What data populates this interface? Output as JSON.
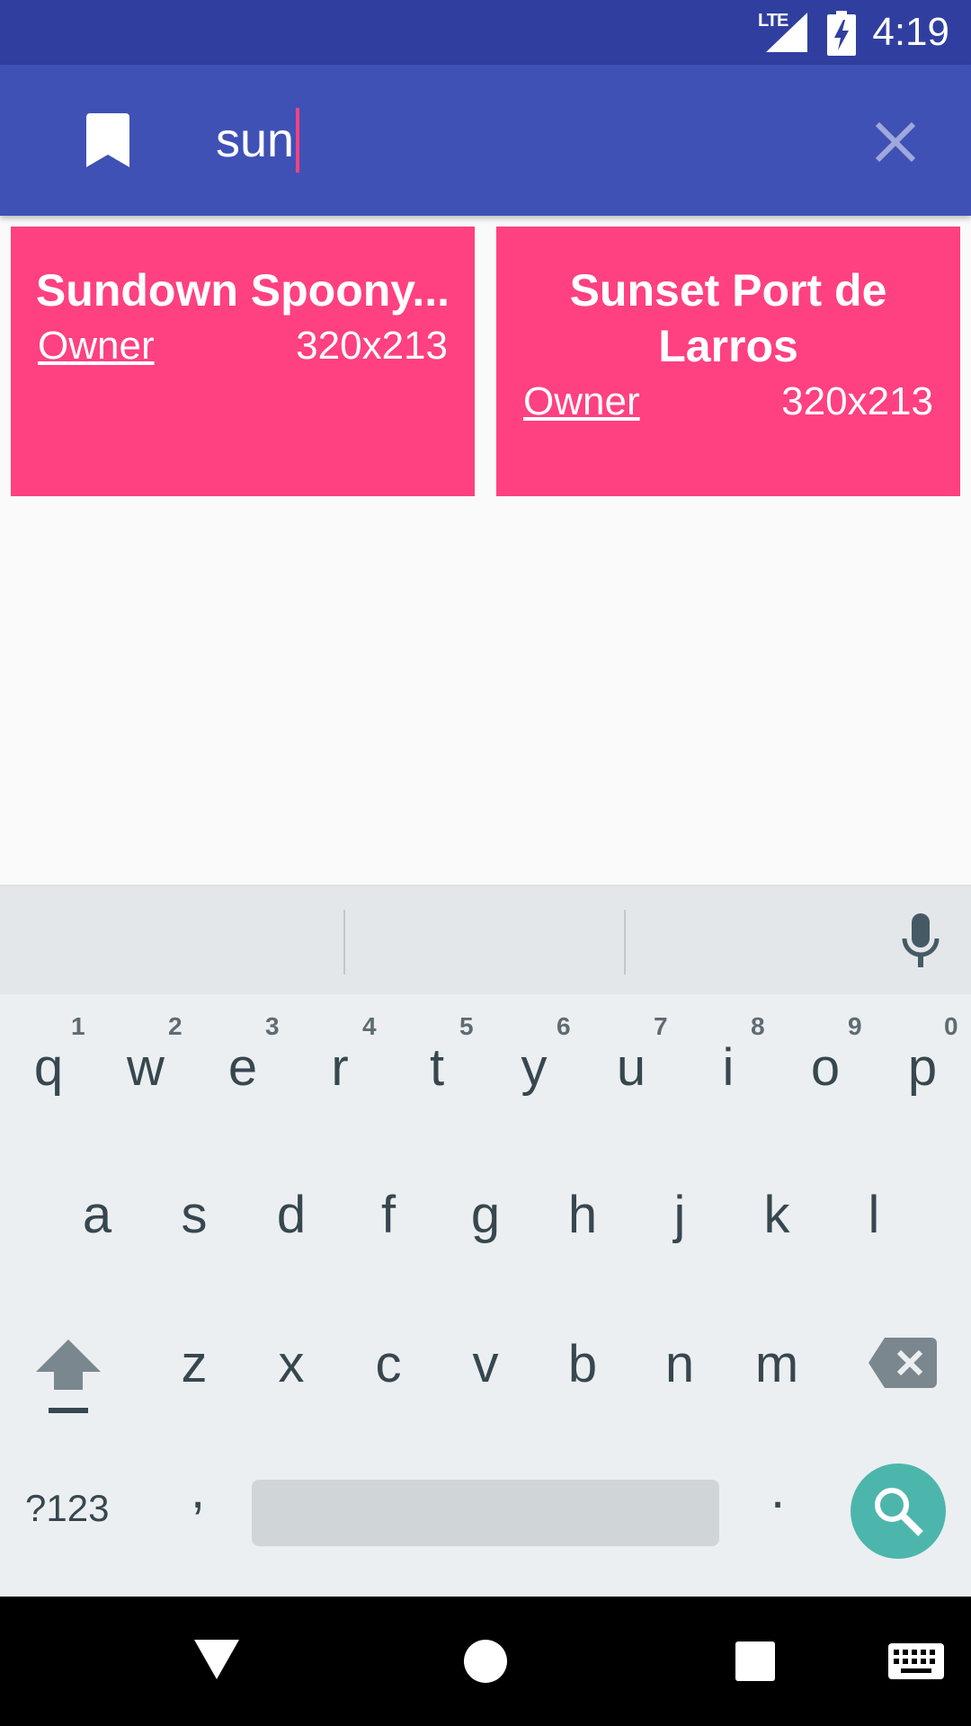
{
  "status_bar": {
    "network_label": "LTE",
    "time": "4:19"
  },
  "toolbar": {
    "search_value": "sun"
  },
  "results": [
    {
      "title": "Sundown Spoony...",
      "owner": "Owner",
      "size": "320x213"
    },
    {
      "title": "Sunset Port de Larros",
      "owner": "Owner",
      "size": "320x213"
    }
  ],
  "keyboard": {
    "row1": [
      "q",
      "w",
      "e",
      "r",
      "t",
      "y",
      "u",
      "i",
      "o",
      "p"
    ],
    "row1_hints": [
      "1",
      "2",
      "3",
      "4",
      "5",
      "6",
      "7",
      "8",
      "9",
      "0"
    ],
    "row2": [
      "a",
      "s",
      "d",
      "f",
      "g",
      "h",
      "j",
      "k",
      "l"
    ],
    "row3": [
      "z",
      "x",
      "c",
      "v",
      "b",
      "n",
      "m"
    ],
    "symbols_key": "?123",
    "comma_key": ",",
    "period_key": "."
  },
  "colors": {
    "status_bar": "#303f9f",
    "toolbar": "#3f51b5",
    "card": "#ff4081",
    "search_key": "#4db6ac"
  },
  "icons": [
    "bookmark-icon",
    "clear-icon",
    "mic-icon",
    "shift-icon",
    "backspace-icon",
    "search-icon",
    "nav-back-icon",
    "nav-home-icon",
    "nav-recents-icon",
    "nav-keyboard-icon"
  ]
}
